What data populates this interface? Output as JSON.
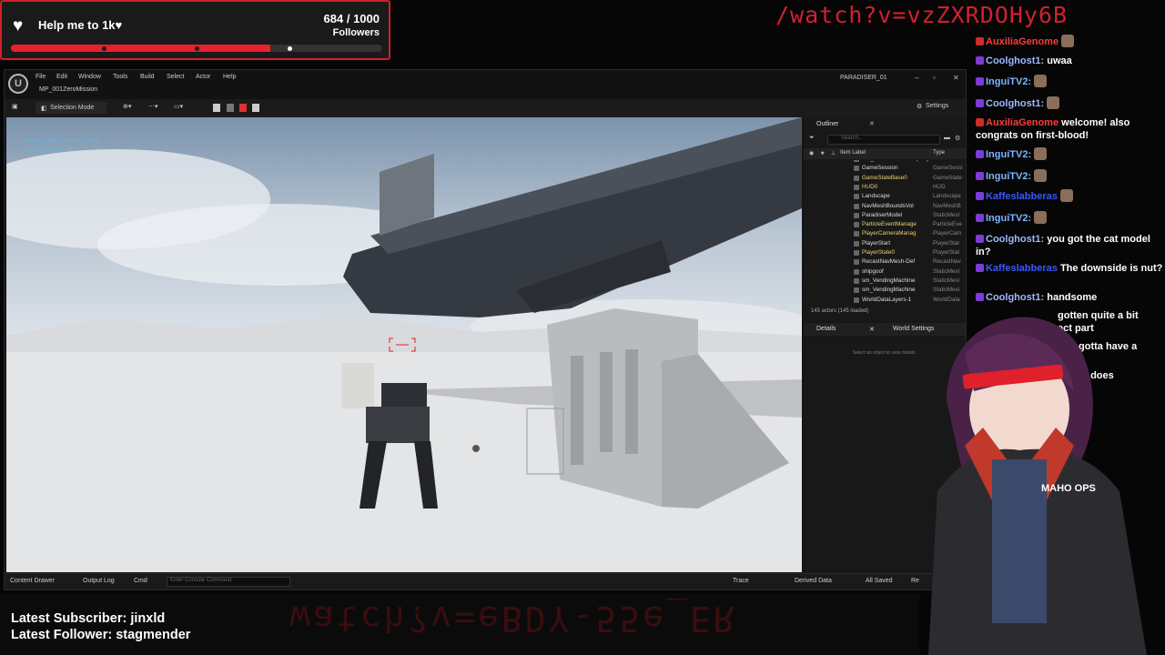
{
  "goal": {
    "title": "Help me to 1k♥",
    "count": "684 / 1000",
    "unit": "Followers",
    "progress_fraction": 0.684
  },
  "overlay_url": "/watch?v=vzZXRDOHy6B",
  "editor": {
    "menu": [
      "File",
      "Edit",
      "Window",
      "Tools",
      "Build",
      "Select",
      "Actor",
      "Help"
    ],
    "level_tab": "MP_001ZeroMission",
    "project_name": "PARADISER_01",
    "selection_mode": "Selection Mode",
    "settings_label": "Settings",
    "hud_lines": [
      "Health: 100 / Armor: 100.0",
      "Left Shoulder: 12"
    ],
    "statusbar": {
      "content_drawer": "Content Drawer",
      "output_log": "Output Log",
      "cmd": "Cmd",
      "console_placeholder": "Enter Console Command",
      "trace": "Trace",
      "derived_data": "Derived Data",
      "all_saved": "All Saved",
      "revision": "Re"
    },
    "outliner": {
      "title": "Outliner",
      "search_placeholder": "Search...",
      "col_label": "Item Label",
      "col_type": "Type",
      "rows": [
        {
          "name": "MP_001ZeroMission (Play In Edito",
          "type": ""
        },
        {
          "name": "GameSession",
          "type": "GameSessi"
        },
        {
          "name": "GameStateBase0",
          "type": "GameState"
        },
        {
          "name": "HUD0",
          "type": "HUD"
        },
        {
          "name": "Landscape",
          "type": "Landscape"
        },
        {
          "name": "NavMeshBoundsVol",
          "type": "NavMeshB"
        },
        {
          "name": "ParadiserModel",
          "type": "StaticMesl"
        },
        {
          "name": "ParticleEventManage",
          "type": "ParticleEve"
        },
        {
          "name": "PlayerCameraManag",
          "type": "PlayerCam"
        },
        {
          "name": "PlayerStart",
          "type": "PlayerStar"
        },
        {
          "name": "PlayerState0",
          "type": "PlayerStat"
        },
        {
          "name": "RecastNavMesh-Def",
          "type": "RecastNav"
        },
        {
          "name": "shipgoof",
          "type": "StaticMesl"
        },
        {
          "name": "sm_VendingMachine",
          "type": "StaticMesl"
        },
        {
          "name": "sm_VendingMachine",
          "type": "StaticMesl"
        },
        {
          "name": "WorldDataLayers-1",
          "type": "WorldData"
        }
      ],
      "count": "145 actors (145 loaded)"
    },
    "details": {
      "tab_details": "Details",
      "tab_world": "World Settings",
      "hint": "Select an object to view details."
    }
  },
  "chat": [
    {
      "user": "AuxiliaGenome",
      "color": "#ff3b3b",
      "msg": ""
    },
    {
      "user": "Coolghost1:",
      "color": "#9fb6ff",
      "msg": "uwaa"
    },
    {
      "user": "InguiTV2:",
      "color": "#7db4ff",
      "msg": ""
    },
    {
      "user": "Coolghost1:",
      "color": "#9fb6ff",
      "msg": ""
    },
    {
      "user": "AuxiliaGenome",
      "color": "#ff3b3b",
      "msg": "welcome! also congrats on first-blood!"
    },
    {
      "user": "InguiTV2:",
      "color": "#7db4ff",
      "msg": ""
    },
    {
      "user": "InguiTV2:",
      "color": "#7db4ff",
      "msg": ""
    },
    {
      "user": "Kaffeslabberas",
      "color": "#3b57ff",
      "msg": ""
    },
    {
      "user": "InguiTV2:",
      "color": "#7db4ff",
      "msg": ""
    },
    {
      "user": "Coolghost1:",
      "color": "#9fb6ff",
      "msg": "you got the cat model in?"
    },
    {
      "user": "Kaffeslabberas",
      "color": "#3b57ff",
      "msg": "The downside is nut?"
    },
    {
      "user": "Coolghost1:",
      "color": "#9fb6ff",
      "msg": "handsome"
    },
    {
      "user": "",
      "color": "#ffffff",
      "msg": "gotten quite a bit"
    },
    {
      "user": "",
      "color": "#ffffff",
      "msg": "ect part"
    },
    {
      "user": "",
      "color": "#ffffff",
      "msg": "You gotta have a"
    },
    {
      "user": "",
      "color": "#ffffff",
      "msg": "nt"
    },
    {
      "user": "",
      "color": "#ffffff",
      "msg": "arklett does"
    }
  ],
  "bottom": {
    "subscriber": "Latest Subscriber: jinxld",
    "follower": "Latest Follower: stagmender",
    "mirrored_text": "watch?v=eBDY-55e_ER"
  },
  "avatar_badge": "MAHO OPS",
  "colors": {
    "accent_red": "#e8212d",
    "chat_purple": "#7d3bd8",
    "outliner_yellow": "#e9d36a"
  }
}
